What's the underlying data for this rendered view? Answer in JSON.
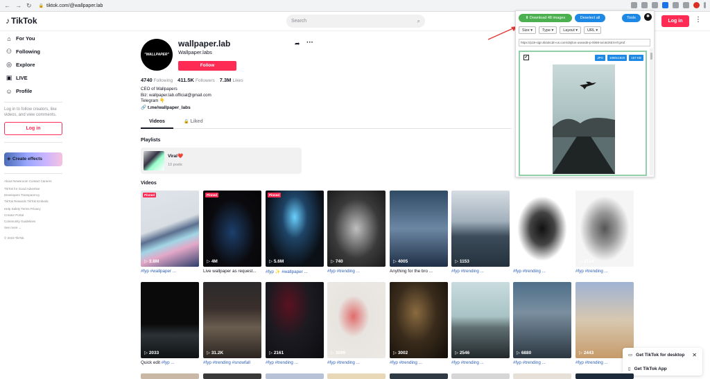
{
  "browser": {
    "url": "tiktok.com/@wallpaper.lab"
  },
  "header": {
    "logo": "TikTok",
    "search_placeholder": "Search",
    "login_label": "Log in"
  },
  "sidebar": {
    "nav": [
      {
        "label": "For You",
        "icon": "home-icon"
      },
      {
        "label": "Following",
        "icon": "users-icon"
      },
      {
        "label": "Explore",
        "icon": "compass-icon"
      },
      {
        "label": "LIVE",
        "icon": "live-icon"
      },
      {
        "label": "Profile",
        "icon": "person-icon"
      }
    ],
    "login_prompt": "Log in to follow creators, like videos, and view comments.",
    "login_label": "Log in",
    "create_effects": "Create effects",
    "footer_lines": [
      "About  Newsroom  Contact  Careers",
      "TikTok for Good  Advertise",
      "Developers  Transparency",
      "TikTok Rewards  TikTok Embeds",
      "Help  Safety  Terms  Privacy",
      "Creator Portal",
      "Community Guidelines",
      "See more ⌄"
    ],
    "copyright": "© 2023 TikTok"
  },
  "profile": {
    "avatar_text": "\"WALLPAPER\"",
    "username": "wallpaper.lab",
    "display_name": "Wallpaper.labs",
    "follow_label": "Follow",
    "following_count": "4740",
    "following_label": "Following",
    "followers_count": "411.5K",
    "followers_label": "Followers",
    "likes_count": "7.3M",
    "likes_label": "Likes",
    "bio_lines": [
      "CEO of Wallpapers",
      "Biz: wallpaper.lab.official@gmail.com",
      "Telegram 👇"
    ],
    "link": "t.me/wallpaper_labs"
  },
  "tabs": {
    "videos": "Videos",
    "liked": "Liked"
  },
  "playlists": {
    "title": "Playlists",
    "name": "Viral❤️",
    "count": "10 posts"
  },
  "videos": {
    "title": "Videos",
    "items": [
      {
        "views": "3.8M",
        "pinned": "Pinned",
        "caption_tag": "#fyp #wallpaper ...",
        "caption": "",
        "bg": "linear-gradient(160deg,#dfe5e9 0%,#d7dde3 45%,#5b6f8f 55%,#a3d6e6 65%,#e3a8c8 75%,#2c3d6a 100%)"
      },
      {
        "views": "4M",
        "pinned": "Pinned",
        "caption_tag": "",
        "caption": "Live wallpaper as request...",
        "bg": "radial-gradient(ellipse at 50% 55%,#1d3f6b 0%,#0b0b0f 55%,#050507 100%)"
      },
      {
        "views": "5.6M",
        "pinned": "Pinned",
        "caption_tag": "#fyp ✨ #wallpaper ...",
        "caption": "",
        "bg": "radial-gradient(ellipse at 50% 35%,#6ad0ff 0%,#1f4466 30%,#0b1017 70%)"
      },
      {
        "views": "740",
        "pinned": "",
        "caption_tag": "#fyp #trending ...",
        "caption": "",
        "bg": "radial-gradient(ellipse at 50% 50%,#bfbfbf 0%,#3a3a3a 55%,#1a1a1a 100%)"
      },
      {
        "views": "4005",
        "pinned": "",
        "caption_tag": "",
        "caption": "Anything for the bro ...",
        "bg": "linear-gradient(180deg,#2f4a63 0%,#6c87a4 50%,#1e2f45 100%)"
      },
      {
        "views": "1153",
        "pinned": "",
        "caption_tag": "#fyp #trending ...",
        "caption": "",
        "bg": "linear-gradient(180deg,#d6dde3 0%,#a2b1bd 40%,#3d4c5a 60%,#24313d 100%)"
      },
      {
        "views": "2516",
        "pinned": "",
        "caption_tag": "#fyp #trending ...",
        "caption": "",
        "bg": "radial-gradient(ellipse at 50% 50%,#111 0%,#444 30%,#fff 60%)"
      },
      {
        "views": "3124",
        "pinned": "",
        "caption_tag": "#fyp #trending ...",
        "caption": "",
        "bg": "radial-gradient(ellipse at 50% 50%,#555 0%,#999 30%,#f5f5f5 60%)"
      },
      {
        "views": "2033",
        "pinned": "",
        "caption_tag": "#fyp ...",
        "caption": "Quick edit ",
        "bg": "linear-gradient(180deg,#0a0a0a 0%,#0a0a0a 55%,#2c3236 70%,#0f1215 100%)"
      },
      {
        "views": "31.2K",
        "pinned": "",
        "caption_tag": "#fyp #trending #snowfall",
        "caption": "",
        "bg": "linear-gradient(180deg,#2b2a2c 0%,#3a2f2b 35%,#6a5d50 60%,#2b2420 100%)"
      },
      {
        "views": "2161",
        "pinned": "",
        "caption_tag": "#fyp #trending ...",
        "caption": "",
        "bg": "radial-gradient(ellipse at 40% 30%,#5a1220 0%,#1a1a20 45%,#0c0c10 100%)"
      },
      {
        "views": "3099",
        "pinned": "",
        "caption_tag": "#fyp #trending ...",
        "caption": "",
        "bg": "radial-gradient(ellipse at 45% 45%,#e06c6c 0%,#e8e4df 35%,#ece9e4 100%)"
      },
      {
        "views": "3002",
        "pinned": "",
        "caption_tag": "#fyp #trending ...",
        "caption": "",
        "bg": "radial-gradient(ellipse at 45% 40%,#8a6b40 0%,#3a2c1c 45%,#120d08 100%)"
      },
      {
        "views": "2546",
        "pinned": "",
        "caption_tag": "#fyp #trending ...",
        "caption": "",
        "bg": "linear-gradient(180deg,#c9dce0 0%,#a8c3c5 45%,#5f6f72 60%,#22282a 100%)"
      },
      {
        "views": "6880",
        "pinned": "",
        "caption_tag": "#fyp #trending ...",
        "caption": "",
        "bg": "linear-gradient(180deg,#4e6f8a 0%,#7a8fa0 40%,#2b3640 100%)"
      },
      {
        "views": "2443",
        "pinned": "",
        "caption_tag": "#fyp #trending ...",
        "caption": "",
        "bg": "linear-gradient(180deg,#9fb3d4 0%,#d8c8b0 50%,#c69b6a 100%)"
      }
    ],
    "strip_colors": [
      "#c9b8a5",
      "#3a3a3a",
      "#b7c2d6",
      "#e9d8b8",
      "#2f3a45",
      "#d6d6d6",
      "#e6e0d8",
      "#1c2a3a"
    ]
  },
  "extension": {
    "download_label": "⬇ Download 48 images",
    "deselect_label": "Deselect all",
    "tools_label": "Tools",
    "filters": [
      "Size ▾",
      "Type ▾",
      "Layout ▾",
      "URL ▾"
    ],
    "url_text": "https://p19-sign.tiktokcdn-us.com/obj/tos-useast5-p-0068-tx/o63XEXATgXsf",
    "checkbox_mark": "✔",
    "badges": [
      "JPG",
      "1080x1920",
      "157 KB"
    ]
  },
  "app_prompt": {
    "desktop": "Get TikTok for desktop",
    "app": "Get TikTok App"
  }
}
